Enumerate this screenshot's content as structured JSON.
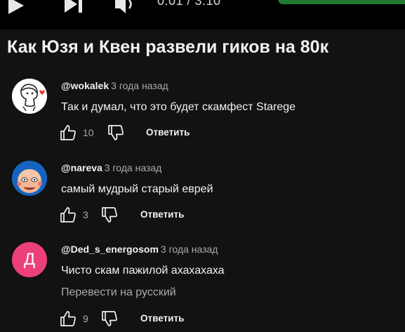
{
  "player": {
    "time": "0:01 / 3:10"
  },
  "video": {
    "title": "Как Юзя и Квен развели гиков на 80к"
  },
  "comments": [
    {
      "author": "@wokalek",
      "time": "3 года назад",
      "text": "Так и думал, что это будет скамфест Starege",
      "likes": "10",
      "reply_label": "Ответить"
    },
    {
      "author": "@nareva",
      "time": "3 года назад",
      "text": "самый мудрый старый еврей",
      "likes": "3",
      "reply_label": "Ответить"
    },
    {
      "author": "@Ded_s_energosom",
      "time": "3 года назад",
      "text": "Чисто скам пажилой ахахахаха",
      "translate": "Перевести на русский",
      "likes": "9",
      "reply_label": "Ответить",
      "avatar_letter": "Д",
      "avatar_color": "#ec407a"
    }
  ]
}
